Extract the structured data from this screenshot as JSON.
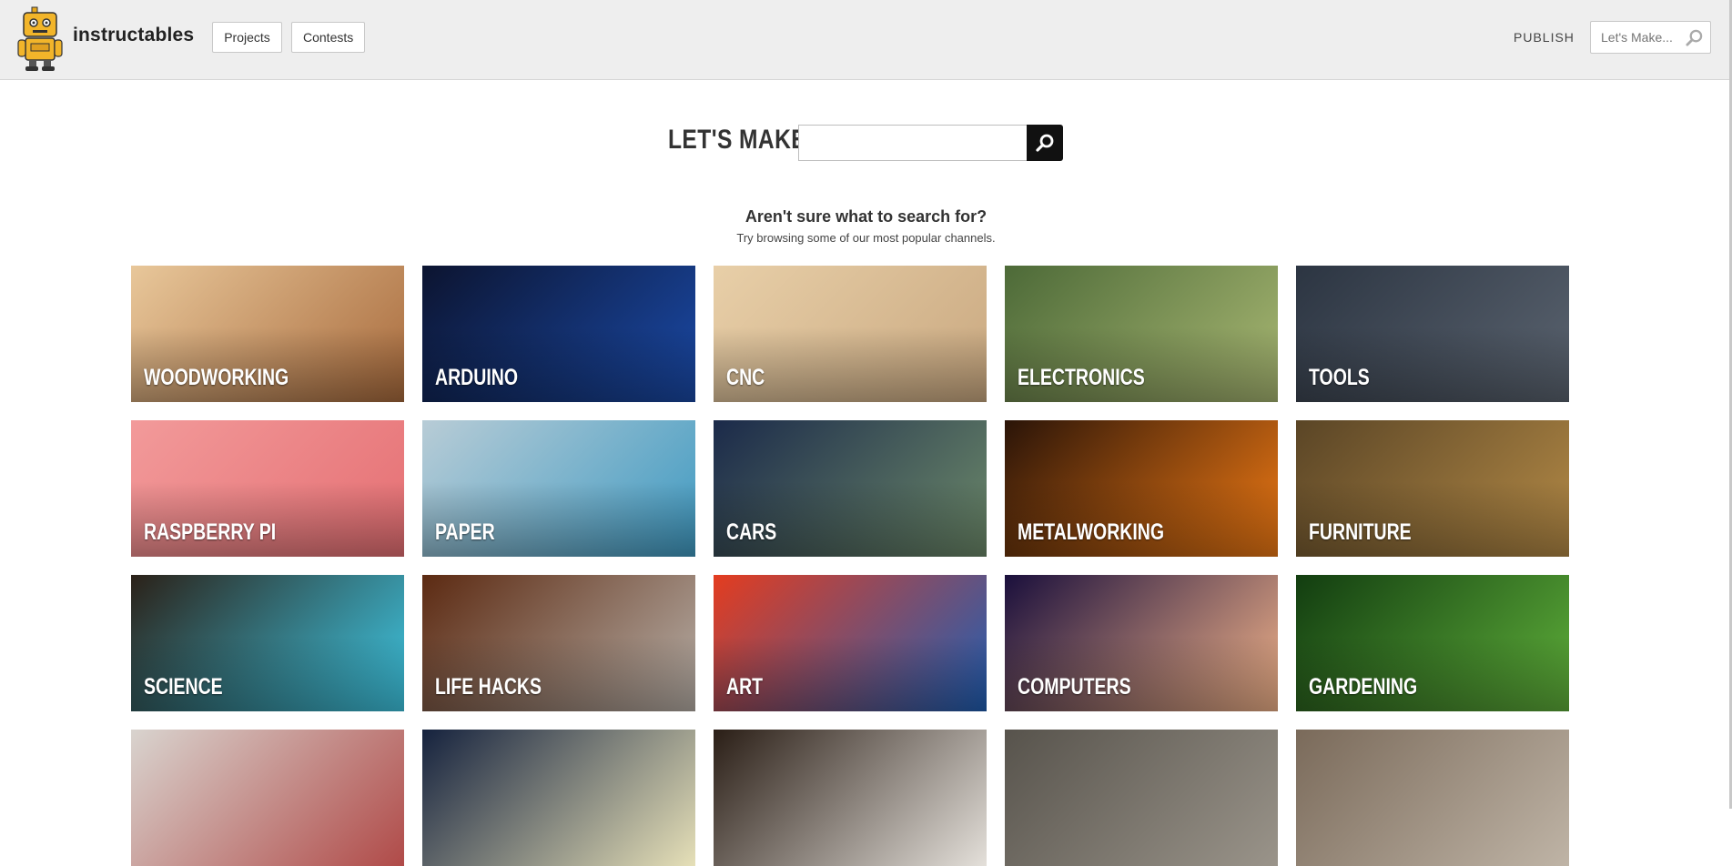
{
  "header": {
    "brand": "instructables",
    "nav": [
      {
        "label": "Projects"
      },
      {
        "label": "Contests"
      }
    ],
    "publish_label": "PUBLISH",
    "search_placeholder": "Let's Make..."
  },
  "hero": {
    "title": "LET'S MAKE:",
    "input_value": ""
  },
  "prompt": {
    "title": "Aren't sure what to search for?",
    "subtitle": "Try browsing some of our most popular channels."
  },
  "channels": [
    {
      "label": "WOODWORKING",
      "colors": [
        "#e8c79a",
        "#a86a3c"
      ]
    },
    {
      "label": "ARDUINO",
      "colors": [
        "#0c1430",
        "#1a4aa8"
      ]
    },
    {
      "label": "CNC",
      "colors": [
        "#e8cfa8",
        "#c9a880"
      ]
    },
    {
      "label": "ELECTRONICS",
      "colors": [
        "#4d6a38",
        "#a9b873"
      ]
    },
    {
      "label": "TOOLS",
      "colors": [
        "#2c3542",
        "#5b6470"
      ]
    },
    {
      "label": "RASPBERRY PI",
      "colors": [
        "#f29a9a",
        "#e56f73"
      ]
    },
    {
      "label": "PAPER",
      "colors": [
        "#b8ccd6",
        "#3f9ac2"
      ]
    },
    {
      "label": "CARS",
      "colors": [
        "#1b2a4a",
        "#6d8a6a"
      ]
    },
    {
      "label": "METALWORKING",
      "colors": [
        "#2a1408",
        "#f07a14"
      ]
    },
    {
      "label": "FURNITURE",
      "colors": [
        "#5a4526",
        "#b48a46"
      ]
    },
    {
      "label": "SCIENCE",
      "colors": [
        "#2b2118",
        "#3ec9e6"
      ]
    },
    {
      "label": "LIFE HACKS",
      "colors": [
        "#5c2a12",
        "#b8b0a8"
      ]
    },
    {
      "label": "ART",
      "colors": [
        "#e43c1f",
        "#1e5fb5"
      ]
    },
    {
      "label": "COMPUTERS",
      "colors": [
        "#1a0f3c",
        "#f3b48a"
      ]
    },
    {
      "label": "GARDENING",
      "colors": [
        "#123d10",
        "#5fb03a"
      ]
    },
    {
      "label": "",
      "colors": [
        "#d9d4cf",
        "#b04a48"
      ]
    },
    {
      "label": "",
      "colors": [
        "#15223e",
        "#e6e0b8"
      ]
    },
    {
      "label": "",
      "colors": [
        "#2a1e16",
        "#e4e0da"
      ]
    },
    {
      "label": "",
      "colors": [
        "#57534c",
        "#9a948a"
      ]
    },
    {
      "label": "",
      "colors": [
        "#7a6a5a",
        "#bfb4a6"
      ]
    }
  ]
}
